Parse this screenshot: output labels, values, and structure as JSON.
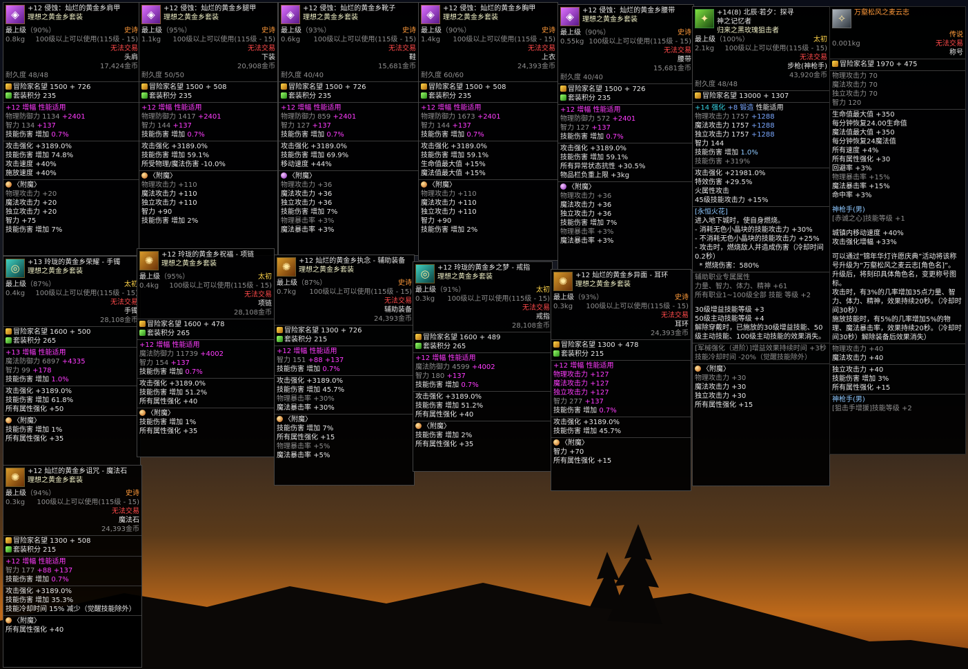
{
  "colors": {
    "epic": "#ff9a3a",
    "legend": "#ff9a3a",
    "primeval": "#ffd44a",
    "no_trade": "#ff4a4a",
    "amp": "#ff3cff",
    "plus": "#4aff4a",
    "bonus": "#7aa8ff"
  },
  "items": [
    {
      "id": "shoulder",
      "icon": "purple",
      "name": "+12 侵蚀：灿烂的黄金乡肩甲",
      "set": "理想之黄金乡套装",
      "level": "最上级",
      "pct": "（90%）",
      "rarity": "史诗",
      "weight": "0.8kg",
      "req": "100级以上可以使用(115级 - 15)",
      "notrade": "无法交易",
      "slot": "头肩",
      "price": "17,424金币",
      "dura": "耐久度 48/48",
      "fame": "冒险家名望 1500 + 726",
      "setpts": "套装积分 235",
      "amp": "+12 增幅 性能适用",
      "s1": [
        "物理防御力 1134 ",
        "+2401"
      ],
      "s2": [
        "智力 134 ",
        "+137"
      ],
      "s3": [
        "技能伤害 增加 ",
        "0.7%"
      ],
      "stats": [
        "攻击强化 +3189.0%",
        "技能伤害 增加 74.8%",
        "攻击速度 +40%",
        "施放速度 +40%"
      ],
      "enchant": "〈附魔〉",
      "ench": [
        [
          "物理攻击力 +20",
          "gy"
        ],
        [
          "魔法攻击力 +20",
          "w"
        ],
        [
          "独立攻击力 +20",
          "w"
        ],
        [
          "智力 +75",
          "w"
        ],
        [
          "技能伤害 增加 7%",
          "w"
        ]
      ]
    },
    {
      "id": "legs",
      "icon": "purple",
      "name": "+12 侵蚀：灿烂的黄金乡腿甲",
      "set": "理想之黄金乡套装",
      "level": "最上级",
      "pct": "（95%）",
      "rarity": "史诗",
      "weight": "1.1kg",
      "req": "100级以上可以使用(115级 - 15)",
      "notrade": "无法交易",
      "slot": "下装",
      "price": "20,908金币",
      "dura": "耐久度 50/50",
      "fame": "冒险家名望 1500 + 508",
      "setpts": "套装积分 235",
      "amp": "+12 增幅 性能适用",
      "s1": [
        "物理防御力 1417 ",
        "+2401"
      ],
      "s2": [
        "智力 144 ",
        "+137"
      ],
      "s3": [
        "技能伤害 增加 ",
        "0.7%"
      ],
      "stats": [
        "攻击强化 +3189.0%",
        "技能伤害 增加 59.1%",
        "所受物理/魔法伤害 -10.0%"
      ],
      "enchant": "〈附魔〉",
      "ench": [
        [
          "物理攻击力 +110",
          "gy"
        ],
        [
          "魔法攻击力 +110",
          "w"
        ],
        [
          "独立攻击力 +110",
          "w"
        ],
        [
          "智力 +90",
          "w"
        ],
        [
          "技能伤害 增加 2%",
          "w"
        ]
      ]
    },
    {
      "id": "shoes",
      "icon": "purple",
      "name": "+12 侵蚀：灿烂的黄金乡靴子",
      "set": "理想之黄金乡套装",
      "level": "最上级",
      "pct": "（93%）",
      "rarity": "史诗",
      "weight": "0.6kg",
      "req": "100级以上可以使用(115级 - 15)",
      "notrade": "无法交易",
      "slot": "鞋",
      "price": "15,681金币",
      "dura": "耐久度 40/40",
      "fame": "冒险家名望 1500 + 726",
      "setpts": "套装积分 235",
      "amp": "+12 增幅 性能适用",
      "s1": [
        "物理防御力 859 ",
        "+2401"
      ],
      "s2": [
        "智力 127 ",
        "+137"
      ],
      "s3": [
        "技能伤害 增加 ",
        "0.7%"
      ],
      "stats": [
        "攻击强化 +3189.0%",
        "技能伤害 增加 69.9%",
        "移动速度 +44%"
      ],
      "enchant": "〈附魔〉",
      "ench": [
        [
          "物理攻击力 +36",
          "gy"
        ],
        [
          "魔法攻击力 +36",
          "w"
        ],
        [
          "独立攻击力 +36",
          "w"
        ],
        [
          "技能伤害 增加 7%",
          "w"
        ],
        [
          "物理暴击率 +3%",
          "gy"
        ],
        [
          "魔法暴击率 +3%",
          "w"
        ]
      ]
    },
    {
      "id": "chest",
      "icon": "purple",
      "name": "+12 侵蚀：灿烂的黄金乡胸甲",
      "set": "理想之黄金乡套装",
      "level": "最上级",
      "pct": "（90%）",
      "rarity": "史诗",
      "weight": "1.4kg",
      "req": "100级以上可以使用(115级 - 15)",
      "notrade": "无法交易",
      "slot": "上衣",
      "price": "24,393金币",
      "dura": "耐久度 60/60",
      "fame": "冒险家名望 1500 + 508",
      "setpts": "套装积分 235",
      "amp": "+12 增幅 性能适用",
      "s1": [
        "物理防御力 1673 ",
        "+2401"
      ],
      "s2": [
        "智力 144 ",
        "+137"
      ],
      "s3": [
        "技能伤害 增加 ",
        "0.7%"
      ],
      "stats": [
        "攻击强化 +3189.0%",
        "技能伤害 增加 59.1%",
        "生命值最大值 +15%",
        "魔法值最大值 +15%"
      ],
      "enchant": "〈附魔〉",
      "ench": [
        [
          "物理攻击力 +110",
          "gy"
        ],
        [
          "魔法攻击力 +110",
          "w"
        ],
        [
          "独立攻击力 +110",
          "w"
        ],
        [
          "智力 +90",
          "w"
        ],
        [
          "技能伤害 增加 2%",
          "w"
        ]
      ]
    },
    {
      "id": "belt",
      "icon": "purple",
      "name": "+12 侵蚀：灿烂的黄金乡腰带",
      "set": "理想之黄金乡套装",
      "level": "最上级",
      "pct": "（90%）",
      "rarity": "史诗",
      "weight": "0.55kg",
      "req": "100级以上可以使用(115级 - 15)",
      "notrade": "无法交易",
      "slot": "腰带",
      "price": "15,681金币",
      "dura": "耐久度 40/40",
      "fame": "冒险家名望 1500 + 726",
      "setpts": "套装积分 235",
      "amp": "+12 增幅 性能适用",
      "s1": [
        "物理防御力 572 ",
        "+2401"
      ],
      "s2": [
        "智力 127 ",
        "+137"
      ],
      "s3": [
        "技能伤害 增加 ",
        "0.7%"
      ],
      "stats": [
        "攻击强化 +3189.0%",
        "技能伤害 增加 59.1%",
        "所有异常状态抗性 +30.5%",
        "物品栏负重上限 +3kg"
      ],
      "enchant": "〈附魔〉",
      "ench": [
        [
          "物理攻击力 +36",
          "gy"
        ],
        [
          "魔法攻击力 +36",
          "w"
        ],
        [
          "独立攻击力 +36",
          "w"
        ],
        [
          "技能伤害 增加 7%",
          "w"
        ],
        [
          "物理暴击率 +3%",
          "gy"
        ],
        [
          "魔法暴击率 +3%",
          "w"
        ]
      ]
    },
    {
      "id": "bracelet",
      "icon": "teal",
      "name": "+13 玲珑的黄金乡荣耀 - 手镯",
      "set": "理想之黄金乡套装",
      "level": "最上级",
      "pct": "（87%）",
      "rarity": "太初",
      "weight": "0.4kg",
      "req": "100级以上可以使用(115级 - 15)",
      "notrade": "无法交易",
      "slot": "手镯",
      "price": "28,108金币",
      "dura": "",
      "fame": "冒险家名望 1600 + 500",
      "setpts": "套装积分 265",
      "amp": "+13 增幅 性能适用",
      "s1": [
        "魔法防御力 6897 ",
        "+4335"
      ],
      "s2": [
        "智力 99 ",
        "+178"
      ],
      "s3": [
        "技能伤害 增加 ",
        "1.0%"
      ],
      "stats": [
        "攻击强化 +3189.0%",
        "技能伤害 增加 61.8%",
        "所有属性强化 +50"
      ],
      "enchant": "〈附魔〉",
      "ench": [
        [
          "技能伤害 增加 1%",
          "w"
        ],
        [
          "所有属性强化 +35",
          "w"
        ]
      ]
    },
    {
      "id": "necklace",
      "icon": "",
      "name": "+12 玲珑的黄金乡祝福 - 项链",
      "set": "理想之黄金乡套装",
      "level": "最上级",
      "pct": "（95%）",
      "rarity": "太初",
      "weight": "0.4kg",
      "req": "100级以上可以使用(115级 - 15)",
      "notrade": "无法交易",
      "slot": "项链",
      "price": "28,108金币",
      "dura": "",
      "fame": "冒险家名望 1600 + 478",
      "setpts": "套装积分 265",
      "amp": "+12 增幅 性能适用",
      "s1": [
        "魔法防御力 11739 ",
        "+4002"
      ],
      "s2": [
        "智力 154 ",
        "+137"
      ],
      "s3": [
        "技能伤害 增加 ",
        "0.7%"
      ],
      "stats": [
        "攻击强化 +3189.0%",
        "技能伤害 增加 51.2%",
        "所有属性强化 +40"
      ],
      "enchant": "〈附魔〉",
      "ench": [
        [
          "技能伤害 增加 1%",
          "w"
        ],
        [
          "所有属性强化 +35",
          "w"
        ]
      ]
    },
    {
      "id": "sub",
      "icon": "",
      "name": "+12 灿烂的黄金乡执念 - 辅助装备",
      "set": "理想之黄金乡套装",
      "level": "最上级",
      "pct": "（87%）",
      "rarity": "史诗",
      "weight": "0.7kg",
      "req": "100级以上可以使用(115级 - 15)",
      "notrade": "无法交易",
      "slot": "辅助装备",
      "price": "24,393金币",
      "dura": "",
      "fame": "冒险家名望 1300 + 726",
      "setpts": "套装积分 215",
      "amp": "+12 增幅 性能适用",
      "s1": [
        "",
        "",
        ""
      ],
      "s2": [
        "智力 151 ",
        "+88 +137"
      ],
      "s3": [
        "技能伤害 增加 ",
        "0.7%"
      ],
      "stats": [
        "攻击强化 +3189.0%",
        "技能伤害 增加 45.7%"
      ],
      "stats_gray": [
        "物理暴击率 +30%"
      ],
      "stats2": [
        "魔法暴击率 +30%"
      ],
      "enchant": "〈附魔〉",
      "ench": [
        [
          "技能伤害 增加 7%",
          "w"
        ],
        [
          "所有属性强化 +15",
          "w"
        ],
        [
          "物理暴击率 +5%",
          "gy"
        ],
        [
          "魔法暴击率 +5%",
          "w"
        ]
      ]
    },
    {
      "id": "ring",
      "icon": "teal",
      "name": "+12 玲珑的黄金乡之梦 - 戒指",
      "set": "理想之黄金乡套装",
      "level": "最上级",
      "pct": "（91%）",
      "rarity": "太初",
      "weight": "0.3kg",
      "req": "100级以上可以使用(115级 - 15)",
      "notrade": "无法交易",
      "slot": "戒指",
      "price": "28,108金币",
      "dura": "",
      "fame": "冒险家名望 1600 + 489",
      "setpts": "套装积分 265",
      "amp": "+12 增幅 性能适用",
      "s1": [
        "魔法防御力 4599 ",
        "+4002"
      ],
      "s2": [
        "智力 180 ",
        "+137"
      ],
      "s3": [
        "技能伤害 增加 ",
        "0.7%"
      ],
      "stats": [
        "攻击强化 +3189.0%",
        "技能伤害 增加 51.2%",
        "所有属性强化 +40"
      ],
      "enchant": "〈附魔〉",
      "ench": [
        [
          "技能伤害 增加 2%",
          "w"
        ],
        [
          "所有属性强化 +35",
          "w"
        ]
      ]
    },
    {
      "id": "earring",
      "icon": "",
      "name": "+12 灿烂的黄金乡异面 - 耳环",
      "set": "理想之黄金乡套装",
      "level": "最上级",
      "pct": "（93%）",
      "rarity": "史诗",
      "weight": "0.3kg",
      "req": "100级以上可以使用(115级 - 15)",
      "notrade": "无法交易",
      "slot": "耳环",
      "price": "24,393金币",
      "dura": "",
      "fame": "冒险家名望 1300 + 478",
      "setpts": "套装积分 215",
      "amp": "+12 增幅 性能适用",
      "amp_lines": [
        "物理攻击力 +127",
        "魔法攻击力 +127",
        "独立攻击力 +127"
      ],
      "s1": [
        "",
        "",
        ""
      ],
      "s2": [
        "智力 277 ",
        "+137"
      ],
      "s3": [
        "技能伤害 增加 ",
        "0.7%"
      ],
      "stats": [
        "攻击强化 +3189.0%",
        "技能伤害 增加 45.7%"
      ],
      "enchant": "〈附魔〉",
      "ench": [
        [
          "智力 +70",
          "w"
        ],
        [
          "所有属性强化 +15",
          "w"
        ]
      ]
    },
    {
      "id": "stone",
      "icon": "",
      "name": "+12 灿烂的黄金乡诅咒 - 魔法石",
      "set": "理想之黄金乡套装",
      "level": "最上级",
      "pct": "（94%）",
      "rarity": "史诗",
      "weight": "0.3kg",
      "req": "100级以上可以使用(115级 - 15)",
      "notrade": "无法交易",
      "slot": "魔法石",
      "price": "24,393金币",
      "dura": "",
      "fame": "冒险家名望 1300 + 508",
      "setpts": "套装积分 215",
      "amp": "+12 增幅 性能适用",
      "s1": [
        "",
        "",
        ""
      ],
      "s2": [
        "智力 177 ",
        "+88 +137"
      ],
      "s3": [
        "技能伤害 增加 ",
        "0.7%"
      ],
      "stats": [
        "攻击强化 +3189.0%",
        "技能伤害 增加 35.3%",
        "技能冷却时间 15% 减少（觉醒技能除外）"
      ],
      "enchant": "〈附魔〉",
      "ench": [
        [
          "所有属性强化 +40",
          "w"
        ]
      ]
    }
  ],
  "weapon": {
    "name1": "+14(8) 北辰·若夕：探寻",
    "name2": "神之记忆者",
    "set": "归来之黑玫瑰狙击者",
    "level": "最上级",
    "pct": "（100%）",
    "rarity": "太初",
    "weight": "2.1kg",
    "req": "100级以上可以使用(115级 - 15)",
    "notrade": "无法交易",
    "slot": "步枪(神枪手)",
    "price": "43,920金币",
    "dura": "耐久度 48/48",
    "fame": "冒险家名望 13000 + 1307",
    "reinforce": [
      "+14 强化",
      "+8 锻造",
      "性能适用"
    ],
    "atk": [
      [
        "物理攻击力 1757 ",
        "+1288"
      ],
      [
        "魔法攻击力 1757 ",
        "+1288"
      ],
      [
        "独立攻击力 1757 ",
        "+1288"
      ]
    ],
    "int": "智力 144",
    "skill": [
      "技能伤害 增加 ",
      "1.0%"
    ],
    "skill2": "技能伤害 +319%",
    "stats": [
      "攻击强化 +21981.0%",
      "特效伤害 +29.5%",
      "火属性攻击",
      "45级技能攻击力 +15%"
    ],
    "fire_title": "[永恒火花]",
    "fire_text": "进入地下城时，使自身燃烧。\n- 消耗无色小晶块的技能攻击力 +30%\n- 不消耗无色小晶块的技能攻击力 +25%\n- 攻击时，燃烧敌人并造成伤害（冷却时间0.2秒）\n  * 燃烧伤害：580%",
    "job_title": "辅助职业专属属性",
    "job1": "力量、智力、体力、精神 +61",
    "job2": "所有职业1~100级全部 技能 等级 +2",
    "job3": "30级增益技能等级 +3",
    "job4": "50级主动技能等级 +4",
    "job5": "解除穿戴时，已施放的30级增益技能、50级主动技能、100级主动技能的效果消失。",
    "mech": "[军械强化（进阶）]增益效果持续时间 +3秒",
    "cool": "技能冷却时间 -20%（觉醒技能除外）",
    "enchant": "〈附魔〉",
    "ench": [
      [
        "物理攻击力 +30",
        "gy"
      ],
      [
        "魔法攻击力 +30",
        "w"
      ],
      [
        "独立攻击力 +30",
        "w"
      ],
      [
        "所有属性强化 +15",
        "w"
      ]
    ]
  },
  "title": {
    "name": "万壑松风之麦云志",
    "rarity": "传说",
    "weight": "0.001kg",
    "notrade": "无法交易",
    "slot": "称号",
    "fame": "冒险家名望 1970 + 475",
    "base": [
      "物理攻击力 70",
      "魔法攻击力 70",
      "独立攻击力 70",
      "智力 120"
    ],
    "eff": [
      "生命值最大值 +350",
      "每分钟恢复24.00生命值",
      "魔法值最大值 +350",
      "每分钟恢复24魔法值",
      "所有速度 +4%",
      "所有属性强化 +30",
      "回避率 +3%"
    ],
    "crit_g": "物理暴击率 +15%",
    "crit": "魔法暴击率 +15%",
    "hit": "命中率 +3%",
    "job_head": "神枪手(男)",
    "job_skill": "[赤诚之心]技能等级 +1",
    "town": "城镇内移动速度 +40%",
    "amp": "攻击强化增幅 +33%",
    "desc": "可以通过“锦年华灯许愿庆典”活动将该称号升级为“万壑松风之麦云志[角色名]”。\n升级后，将刻印具体角色名，变更称号图标。\n攻击时，有3%的几率增加35点力量、智力、体力、精神，效果持续20秒。（冷却时间30秒）\n施放技能时，有5%的几率增加5%的物理、魔法暴击率，效果持续20秒。（冷却时间30秒）解除装备后效果消失）",
    "ex_g": "物理攻击力 +40",
    "ex1": "魔法攻击力 +40",
    "ex2": "独立攻击力 +40",
    "ex3": "技能伤害 增加 3%",
    "ex4": "所有属性强化 +15",
    "job2_head": "神枪手(男)",
    "job2_skill": "[狙击手增援]技能等级 +2"
  }
}
